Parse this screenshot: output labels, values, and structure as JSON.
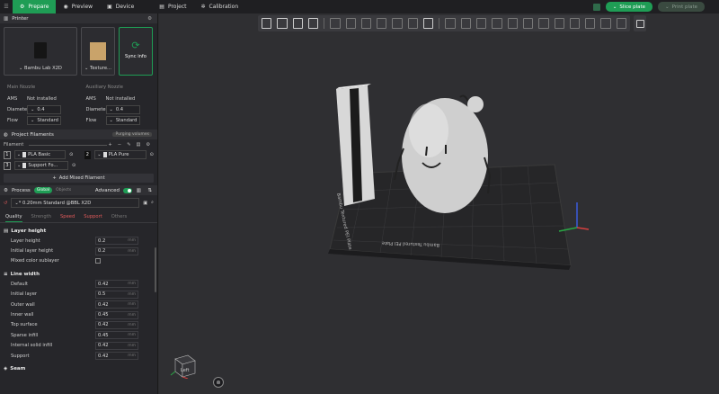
{
  "topbar": {
    "tabs": [
      {
        "label": "Prepare",
        "icon": "prepare-icon",
        "active": true
      },
      {
        "label": "Preview",
        "icon": "preview-icon",
        "active": false
      },
      {
        "label": "Device",
        "icon": "device-icon",
        "active": false
      },
      {
        "label": "Project",
        "icon": "project-icon",
        "active": false
      },
      {
        "label": "Calibration",
        "icon": "calibration-icon",
        "active": false
      }
    ],
    "slice_label": "Slice plate",
    "print_label": "Print plate"
  },
  "printer": {
    "title": "Printer",
    "name": "Bambu Lab X2D",
    "plate": "Texture...",
    "sync": "Sync info",
    "main_nozzle": {
      "title": "Main Nozzle",
      "ams_label": "AMS",
      "ams_value": "Not installed",
      "diameter_label": "Diameter",
      "diameter": "0.4",
      "flow_label": "Flow",
      "flow": "Standard"
    },
    "aux_nozzle": {
      "title": "Auxiliary Nozzle",
      "ams_label": "AMS",
      "ams_value": "Not installed",
      "diameter_label": "Diameter",
      "diameter": "0.4",
      "flow_label": "Flow",
      "flow": "Standard"
    }
  },
  "filaments": {
    "title": "Project Filaments",
    "badge": "Purging volumes",
    "header": "Filament",
    "items": [
      {
        "num": "1",
        "name": "PLA Basic",
        "dark": false
      },
      {
        "num": "2",
        "name": "PLA Pure",
        "dark": true
      },
      {
        "num": "3",
        "name": "Support Fo...",
        "dark": false
      }
    ],
    "add_label": "Add Mixed Filament"
  },
  "process": {
    "title": "Process",
    "global": "Global",
    "objects": "Objects",
    "advanced": "Advanced",
    "preset": "* 0.20mm Standard @BBL X2D",
    "tabs": [
      {
        "label": "Quality",
        "state": "on"
      },
      {
        "label": "Strength",
        "state": "off"
      },
      {
        "label": "Speed",
        "state": "warn"
      },
      {
        "label": "Support",
        "state": "warn"
      },
      {
        "label": "Others",
        "state": "off"
      }
    ],
    "layer_height": {
      "title": "Layer height",
      "rows": [
        {
          "label": "Layer height",
          "value": "0.2",
          "unit": "mm"
        },
        {
          "label": "Initial layer height",
          "value": "0.2",
          "unit": "mm"
        }
      ],
      "mixed_label": "Mixed color sublayer"
    },
    "line_width": {
      "title": "Line width",
      "rows": [
        {
          "label": "Default",
          "value": "0.42",
          "unit": "mm"
        },
        {
          "label": "Initial layer",
          "value": "0.5",
          "unit": "mm"
        },
        {
          "label": "Outer wall",
          "value": "0.42",
          "unit": "mm"
        },
        {
          "label": "Inner wall",
          "value": "0.45",
          "unit": "mm"
        },
        {
          "label": "Top surface",
          "value": "0.42",
          "unit": "mm"
        },
        {
          "label": "Sparse infill",
          "value": "0.45",
          "unit": "mm"
        },
        {
          "label": "Internal solid infill",
          "value": "0.42",
          "unit": "mm"
        },
        {
          "label": "Support",
          "value": "0.42",
          "unit": "mm"
        }
      ]
    },
    "seam_title": "Seam"
  },
  "viewport": {
    "cube_label": "Left",
    "plate_text": "Bambu Textured PEI Plate",
    "plate_text2": "Bambu Textured PEI Plate"
  },
  "colors": {
    "accent": "#1f9d55",
    "warn": "#e05a5a"
  }
}
